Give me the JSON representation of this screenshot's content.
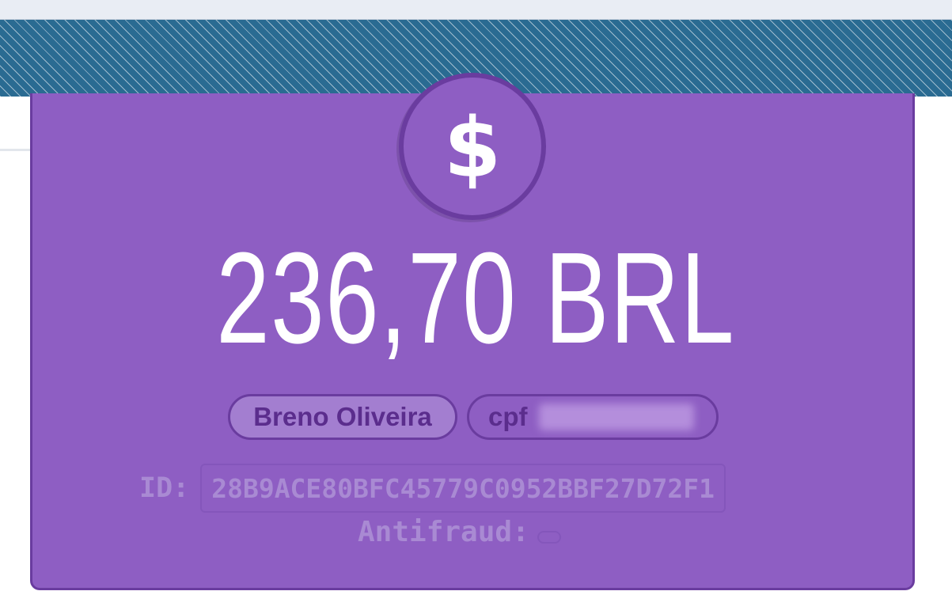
{
  "payment": {
    "currency_symbol": "$",
    "amount": "236,70 BRL",
    "customer_name": "Breno Oliveira",
    "document_type": "cpf",
    "id_label": "ID:",
    "id_value": "28B9ACE80BFC45779C0952BBF27D72F1",
    "antifraud_label": "Antifraud:"
  },
  "colors": {
    "card": "#8e5ec3",
    "card_border": "#6a3c9f",
    "stripe_band": "#2a6b92"
  },
  "icons": {
    "coin": "dollar-coin-icon"
  }
}
